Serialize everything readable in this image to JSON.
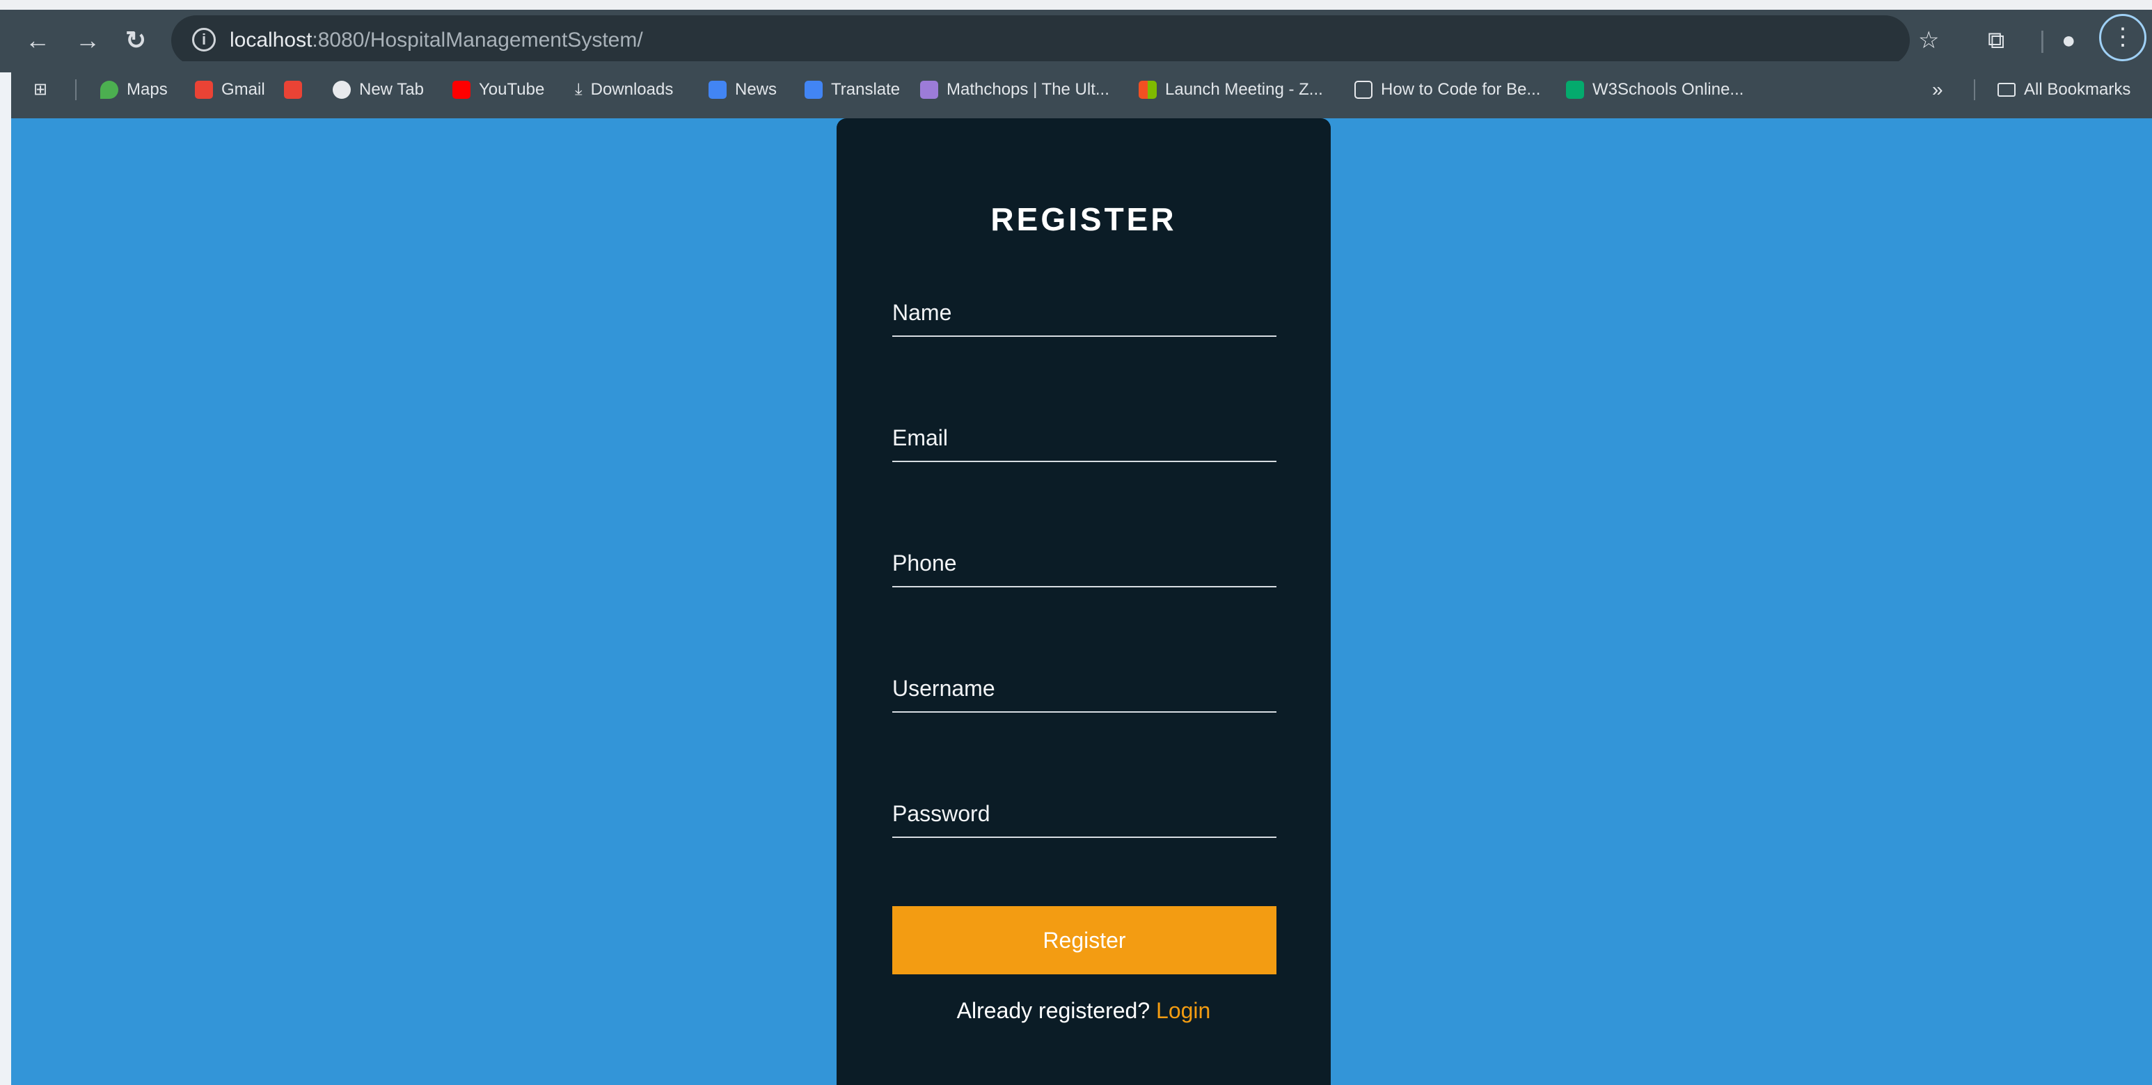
{
  "browser": {
    "url_host": "localhost",
    "url_rest": ":8080/HospitalManagementSystem/",
    "icons": [
      "back-icon",
      "forward-icon",
      "reload-icon",
      "site-info-icon",
      "star-icon",
      "extensions-icon",
      "profile-icon",
      "menu-icon"
    ]
  },
  "bookmarks": {
    "items": [
      {
        "label": "Maps",
        "color": "#4caf50"
      },
      {
        "label": "Gmail",
        "color": "#ea4335"
      },
      {
        "label": "",
        "color": "#ea4335"
      },
      {
        "label": "New Tab",
        "color": "#e8eaed"
      },
      {
        "label": "YouTube",
        "color": "#ff0000"
      },
      {
        "label": "Downloads",
        "color": "#e8eaed"
      },
      {
        "label": "News",
        "color": "#4285f4"
      },
      {
        "label": "Translate",
        "color": "#4285f4"
      },
      {
        "label": "Mathchops | The Ult...",
        "color": "#9c7cd8"
      },
      {
        "label": "Launch Meeting - Z...",
        "color": "#f25022"
      },
      {
        "label": "How to Code for Be...",
        "color": "#e8eaed"
      },
      {
        "label": "W3Schools Online...",
        "color": "#04aa6d"
      }
    ],
    "overflow": "»",
    "all_label": "All Bookmarks"
  },
  "form": {
    "title": "REGISTER",
    "fields": [
      "Name",
      "Email",
      "Phone",
      "Username",
      "Password"
    ],
    "submit_label": "Register",
    "login_prompt": "Already registered?",
    "login_link": "Login"
  },
  "colors": {
    "page_bg": "#3395d8",
    "card_bg": "#0b1c26",
    "accent": "#f39c12"
  }
}
